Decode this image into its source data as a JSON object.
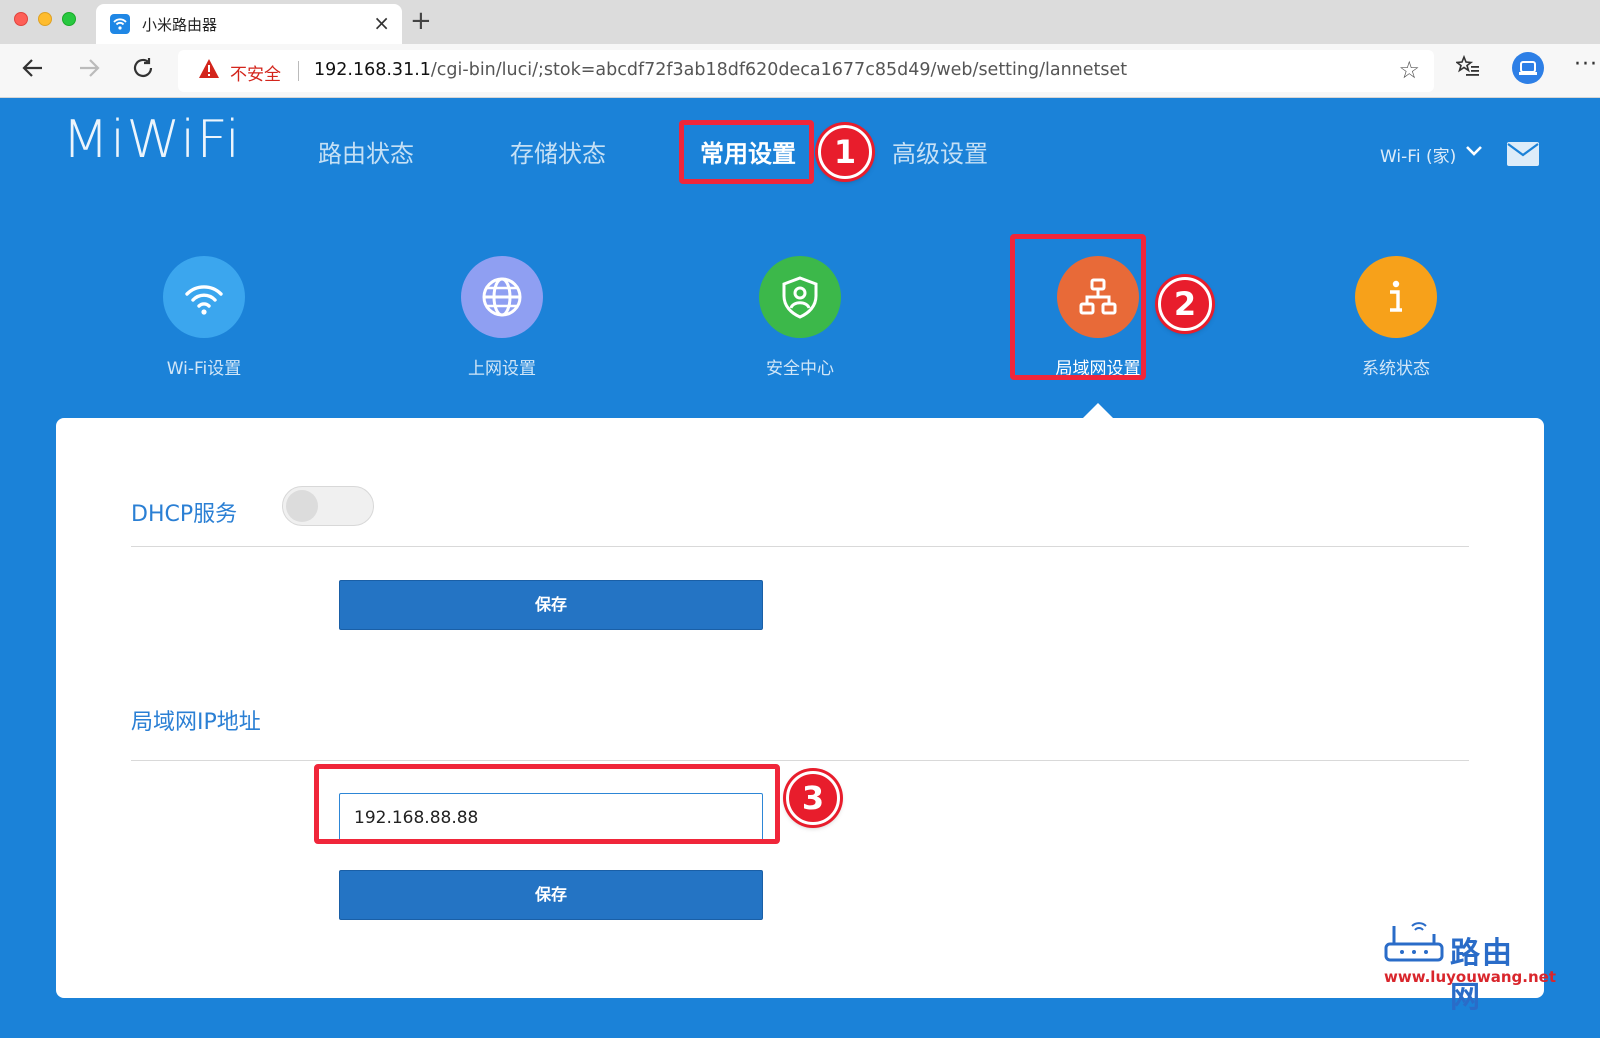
{
  "browser": {
    "tab_title": "小米路由器",
    "tab_close": "×",
    "new_tab": "+",
    "security_label": "不安全",
    "url_host": "192.168.31.1",
    "url_path": "/cgi-bin/luci/;stok=abcdf72f3ab18df620deca1677c85d49/web/setting/lannetset"
  },
  "header": {
    "logo": "MiWiFi",
    "nav": {
      "status": "路由状态",
      "storage": "存储状态",
      "common": "常用设置",
      "advanced": "高级设置"
    },
    "wifi_selector": "Wi-Fi (家)"
  },
  "annotations": {
    "one": "1",
    "two": "2",
    "three": "3"
  },
  "apps": {
    "wifi": "Wi-Fi设置",
    "internet": "上网设置",
    "security": "安全中心",
    "lan": "局域网设置",
    "system": "系统状态"
  },
  "content": {
    "dhcp_title": "DHCP服务",
    "dhcp_enabled": false,
    "save_label": "保存",
    "lan_ip_title": "局域网IP地址",
    "lan_ip_value": "192.168.88.88"
  },
  "watermark": {
    "name": "路由网",
    "url": "www.luyouwang.net"
  },
  "colors": {
    "background": "#1b82d8",
    "annotation_red": "#f0263a",
    "save_button": "#2474c4",
    "section_title": "#2a7fd4"
  }
}
